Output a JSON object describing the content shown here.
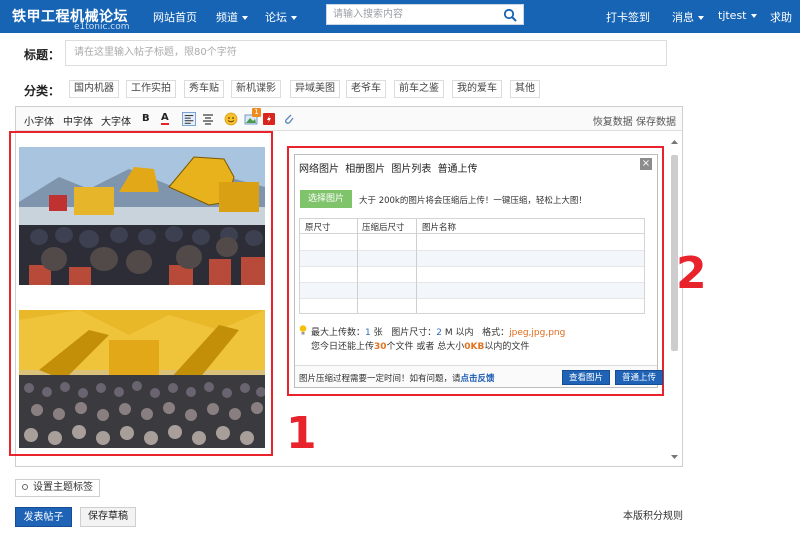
{
  "header": {
    "logo": "铁甲工程机械论坛",
    "logo_sub": "e1tonic.com",
    "nav": {
      "home": "网站首页",
      "channel": "频道",
      "forum": "论坛"
    },
    "search": {
      "placeholder": "请输入搜索内容",
      "icon": "search-icon"
    },
    "right": {
      "checkin": "打卡签到",
      "messages": "消息",
      "user": "tjtest",
      "help": "求助"
    }
  },
  "form": {
    "title_label": "标题：",
    "title_placeholder": "请在这里输入帖子标题，限80个字符",
    "category_label": "分类：",
    "categories": [
      "国内机器",
      "工作实拍",
      "秀车贴",
      "新机谍影",
      "异域美图",
      "老爷车",
      "前车之鉴",
      "我的爱车",
      "其他"
    ]
  },
  "toolbar": {
    "font_small": "小字体",
    "font_medium": "中字体",
    "font_large": "大字体",
    "bold": "B",
    "font_color": "A",
    "right": "恢复数据 保存数据",
    "badge": "1",
    "icons": [
      "bold-icon",
      "font-color-icon",
      "align-left-icon",
      "align-center-icon",
      "emoji-icon",
      "image-icon",
      "flash-icon",
      "attachment-icon"
    ]
  },
  "annotations": {
    "one": "1",
    "two": "2"
  },
  "upload_dialog": {
    "tabs": [
      "网络图片",
      "相册图片",
      "图片列表",
      "普通上传"
    ],
    "close": "×",
    "select_button": "选择图片",
    "note": "大于 200k的图片将会压缩后上传！一键压缩，轻松上大图！",
    "table_headers": [
      "原尺寸",
      "压缩后尺寸",
      "图片名称"
    ],
    "info1_prefix": "最大上传数：",
    "info1_count": "1",
    "info1_unit": "张",
    "info1_size_label": "图片尺寸：",
    "info1_size": "2",
    "info1_size_unit": "M 以内",
    "info1_format_label": "格式：",
    "info1_formats": "jpeg,jpg,png",
    "info2_prefix": "您今日还能上传",
    "info2_count": "30",
    "info2_mid": "个文件 或者 总大小",
    "info2_size": "0KB",
    "info2_suffix": "以内的文件",
    "footer_note": "图片压缩过程需要一定时间！如有问题，请",
    "footer_link": "点击反馈",
    "view_button": "查看图片",
    "upload_button": "普通上传"
  },
  "bottom": {
    "tag_button": "设置主题标签",
    "publish": "发表帖子",
    "save_draft": "保存草稿",
    "rules": "本版积分规则"
  },
  "colors": {
    "brand": "#1764b5",
    "annotation": "#e8232b",
    "button_blue": "#1e63b6"
  }
}
